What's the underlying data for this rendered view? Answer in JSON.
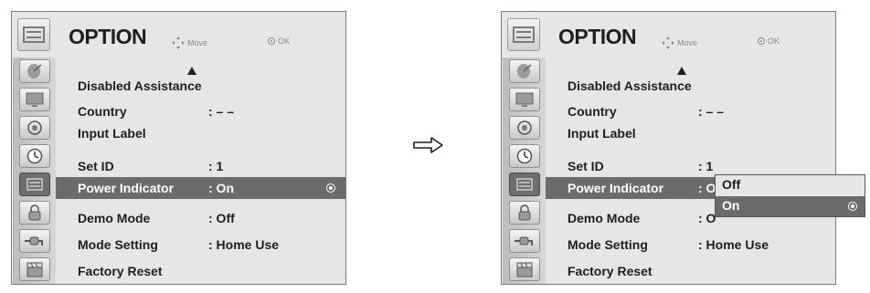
{
  "header": {
    "title": "OPTION",
    "move_label": "Move",
    "ok_label": "OK"
  },
  "menu": {
    "items": [
      {
        "label": "Disabled Assistance",
        "value": ""
      },
      {
        "label": "Country",
        "value": ": – –"
      },
      {
        "label": "Input Label",
        "value": ""
      },
      {
        "label": "Set ID",
        "value": ": 1"
      },
      {
        "label": "Power Indicator",
        "value": ": On"
      },
      {
        "label": "Demo Mode",
        "value": ": Off"
      },
      {
        "label": "Mode Setting",
        "value": ": Home Use"
      },
      {
        "label": "Factory Reset",
        "value": ""
      }
    ],
    "selected_item": "Power Indicator"
  },
  "right_panel": {
    "power_indicator_value_partial": ": O",
    "demo_mode_value_partial": ": O"
  },
  "popup": {
    "options": [
      "Off",
      "On"
    ],
    "selected": "On"
  },
  "sidebar_icons": [
    "satellite-dish-icon",
    "monitor-icon",
    "speaker-icon",
    "clock-icon",
    "option-icon",
    "lock-icon",
    "input-plug-icon",
    "clapper-icon"
  ],
  "colors": {
    "panel_bg": "#e6e6e6",
    "selection": "#6b6b6b",
    "text": "#1e1e1e"
  }
}
